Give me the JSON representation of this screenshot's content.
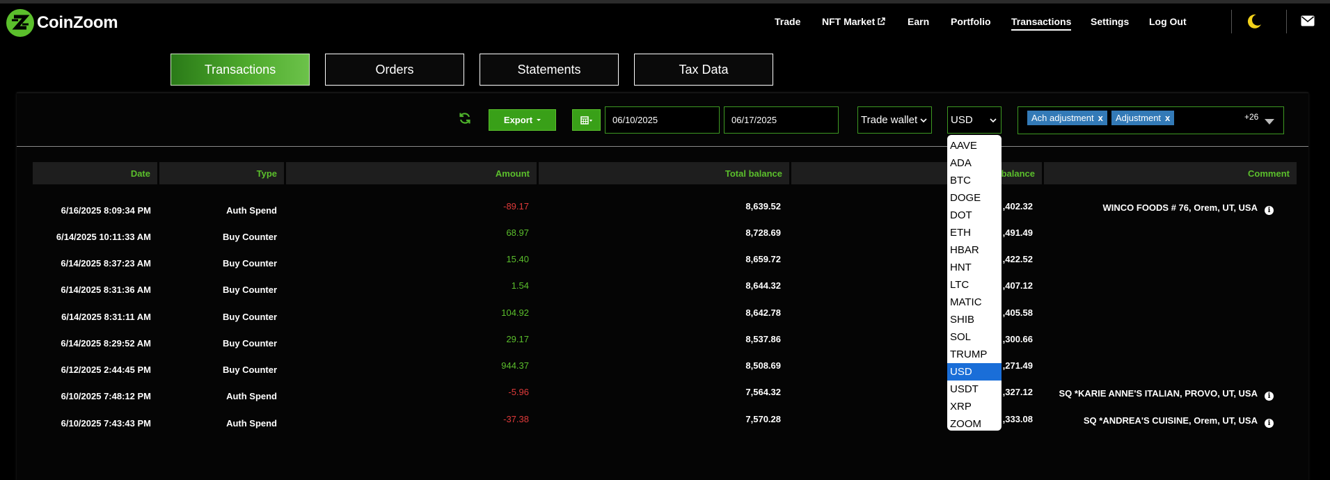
{
  "brand": {
    "name": "CoinZoom"
  },
  "nav": {
    "items": [
      {
        "label": "Trade",
        "active": false
      },
      {
        "label": "NFT Market",
        "active": false,
        "external": true
      },
      {
        "label": "Earn",
        "active": false
      },
      {
        "label": "Portfolio",
        "active": false
      },
      {
        "label": "Transactions",
        "active": true
      },
      {
        "label": "Settings",
        "active": false
      },
      {
        "label": "Log Out",
        "active": false
      }
    ]
  },
  "tabs": [
    {
      "label": "Transactions",
      "active": true
    },
    {
      "label": "Orders",
      "active": false
    },
    {
      "label": "Statements",
      "active": false
    },
    {
      "label": "Tax Data",
      "active": false
    }
  ],
  "filters": {
    "export_label": "Export",
    "date_from": "06/10/2025",
    "date_to": "06/17/2025",
    "wallet": "Trade wallet",
    "currency": "USD",
    "tags": [
      "Ach adjustment",
      "Adjustment"
    ],
    "tags_remove": "x",
    "tags_more": "+26"
  },
  "table": {
    "headers": [
      "Date",
      "Type",
      "Amount",
      "Total balance",
      "balance",
      "Comment"
    ],
    "rows": [
      {
        "date": "6/16/2025 8:09:34 PM",
        "type": "Auth Spend",
        "amount": "-89.17",
        "sign": "neg",
        "total": "8,639.52",
        "balance": ",402.32",
        "comment": "WINCO FOODS # 76, Orem, UT, USA"
      },
      {
        "date": "6/14/2025 10:11:33 AM",
        "type": "Buy Counter",
        "amount": "68.97",
        "sign": "pos",
        "total": "8,728.69",
        "balance": ",491.49",
        "comment": ""
      },
      {
        "date": "6/14/2025 8:37:23 AM",
        "type": "Buy Counter",
        "amount": "15.40",
        "sign": "pos",
        "total": "8,659.72",
        "balance": ",422.52",
        "comment": ""
      },
      {
        "date": "6/14/2025 8:31:36 AM",
        "type": "Buy Counter",
        "amount": "1.54",
        "sign": "pos",
        "total": "8,644.32",
        "balance": ",407.12",
        "comment": ""
      },
      {
        "date": "6/14/2025 8:31:11 AM",
        "type": "Buy Counter",
        "amount": "104.92",
        "sign": "pos",
        "total": "8,642.78",
        "balance": ",405.58",
        "comment": ""
      },
      {
        "date": "6/14/2025 8:29:52 AM",
        "type": "Buy Counter",
        "amount": "29.17",
        "sign": "pos",
        "total": "8,537.86",
        "balance": ",300.66",
        "comment": ""
      },
      {
        "date": "6/12/2025 2:44:45 PM",
        "type": "Buy Counter",
        "amount": "944.37",
        "sign": "pos",
        "total": "8,508.69",
        "balance": ",271.49",
        "comment": ""
      },
      {
        "date": "6/10/2025 7:48:12 PM",
        "type": "Auth Spend",
        "amount": "-5.96",
        "sign": "neg",
        "total": "7,564.32",
        "balance": ",327.12",
        "comment": "SQ *KARIE ANNE'S ITALIAN, PROVO, UT, USA"
      },
      {
        "date": "6/10/2025 7:43:43 PM",
        "type": "Auth Spend",
        "amount": "-37.38",
        "sign": "neg",
        "total": "7,570.28",
        "balance": ",333.08",
        "comment": "SQ *ANDREA'S CUISINE, Orem, UT, USA"
      }
    ]
  },
  "currency_options": [
    "AAVE",
    "ADA",
    "BTC",
    "DOGE",
    "DOT",
    "ETH",
    "HBAR",
    "HNT",
    "LTC",
    "MATIC",
    "SHIB",
    "SOL",
    "TRUMP",
    "USD",
    "USDT",
    "XRP",
    "ZOOM"
  ],
  "currency_selected": "USD",
  "info_glyph": "i",
  "colors": {
    "accent": "#5bbf2c",
    "negative": "#e03a3a",
    "tag": "#337ab7",
    "selected_option": "#1a6ed8"
  },
  "icons": {
    "refresh": "refresh-icon",
    "calendar": "calendar-icon",
    "theme": "moon-icon",
    "mail": "mail-icon",
    "info": "info-icon"
  }
}
